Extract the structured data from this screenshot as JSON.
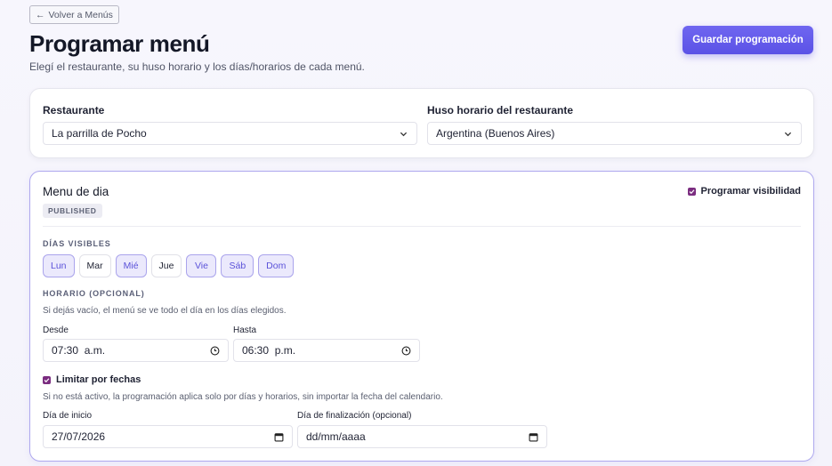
{
  "header": {
    "back_label": "Volver a Menús",
    "title": "Programar menú",
    "subtitle": "Elegí el restaurante, su huso horario y los días/horarios de cada menú.",
    "save_label": "Guardar programación"
  },
  "restaurant": {
    "restaurant_label": "Restaurante",
    "restaurant_value": "La parrilla de Pocho",
    "timezone_label": "Huso horario del restaurante",
    "timezone_value": "Argentina (Buenos Aires)"
  },
  "menu": {
    "name": "Menu de dia",
    "status": "PUBLISHED",
    "schedule_visibility_label": "Programar visibilidad",
    "schedule_visibility_checked": true,
    "days_label": "DÍAS VISIBLES",
    "days": [
      {
        "label": "Lun",
        "active": true
      },
      {
        "label": "Mar",
        "active": false
      },
      {
        "label": "Mié",
        "active": true
      },
      {
        "label": "Jue",
        "active": false
      },
      {
        "label": "Vie",
        "active": true
      },
      {
        "label": "Sáb",
        "active": true
      },
      {
        "label": "Dom",
        "active": true
      }
    ],
    "hours_label": "HORARIO (OPCIONAL)",
    "hours_hint": "Si dejás vacío, el menú se ve todo el día en los días elegidos.",
    "from_label": "Desde",
    "from_value": "07:30  a.m.",
    "to_label": "Hasta",
    "to_value": "06:30  p.m.",
    "limit_dates_label": "Limitar por fechas",
    "limit_dates_checked": true,
    "limit_dates_hint": "Si no está activo, la programación aplica solo por días y horarios, sin importar la fecha del calendario.",
    "start_date_label": "Día de inicio",
    "start_date_value": "27/07/2026",
    "end_date_label": "Día de finalización (opcional)",
    "end_date_value": "dd/mm/aaaa"
  },
  "colors": {
    "accent": "#5b52e6",
    "checkbox": "#7b2d80",
    "day_active_bg": "#ebe9fc"
  }
}
